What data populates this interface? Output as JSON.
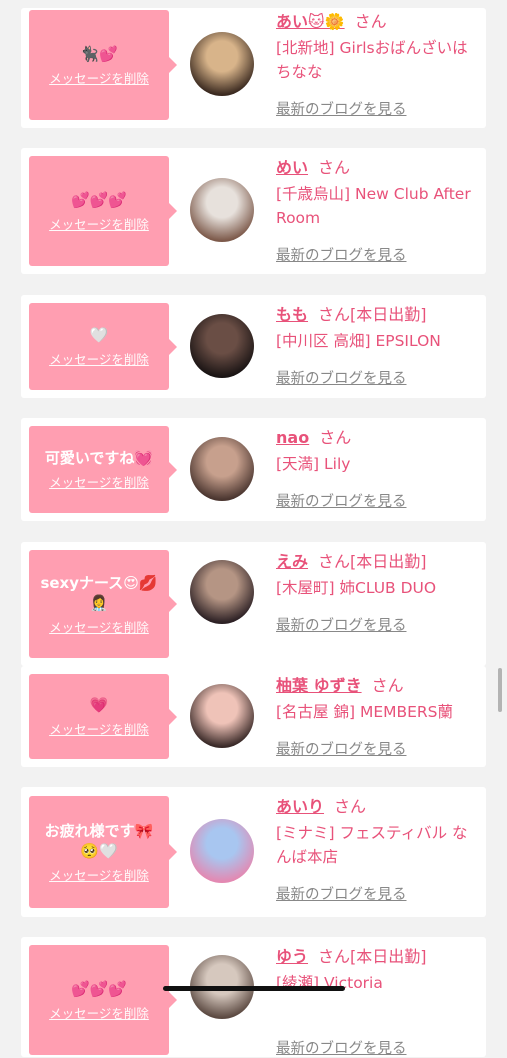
{
  "colors": {
    "accent": "#e8527a",
    "bubble": "#ff9eb1",
    "link_gray": "#888888"
  },
  "entries": [
    {
      "name": "あい🐱🌼",
      "honorific": "さん",
      "status": "",
      "shop": "[北新地] Girlsおばんざいはちなな",
      "message": "🐈‍⬛💕",
      "delete_label": "メッセージを削除",
      "blog_label": "最新のブログを見る",
      "avatar_icon": "avatar-girl-cat-filter"
    },
    {
      "name": "めい",
      "honorific": "さん",
      "status": "",
      "shop": "[千歳烏山] New Club After Room",
      "message": "💕💕💕",
      "delete_label": "メッセージを削除",
      "blog_label": "最新のブログを見る",
      "avatar_icon": "avatar-girl-selfie"
    },
    {
      "name": "もも",
      "honorific": "さん",
      "status": "[本日出勤]",
      "shop": "[中川区 高畑] EPSILON",
      "message": "🤍",
      "delete_label": "メッセージを削除",
      "blog_label": "最新のブログを見る",
      "avatar_icon": "avatar-girl-cat-ears"
    },
    {
      "name": "nao",
      "honorific": "さん",
      "status": "",
      "shop": "[天満] Lily",
      "message": "可愛いですね💓",
      "delete_label": "メッセージを削除",
      "blog_label": "最新のブログを見る",
      "avatar_icon": "avatar-girl-sparkle"
    },
    {
      "name": "えみ",
      "honorific": "さん",
      "status": "[本日出勤]",
      "shop": "[木屋町] 姉CLUB DUO",
      "message": "sexyナース😍💋👩‍⚕️",
      "delete_label": "メッセージを削除",
      "blog_label": "最新のブログを見る",
      "avatar_icon": "avatar-girl-portrait"
    },
    {
      "name": "柚葉 ゆずき",
      "honorific": "さん",
      "status": "",
      "shop": "[名古屋 錦] MEMBERS蘭",
      "message": "💗",
      "delete_label": "メッセージを削除",
      "blog_label": "最新のブログを見る",
      "avatar_icon": "avatar-girl-closeup"
    },
    {
      "name": "あいり",
      "honorific": "さん",
      "status": "",
      "shop": "[ミナミ] フェスティバル なんば本店",
      "message": "お疲れ様です🎀🥺🤍",
      "delete_label": "メッセージを削除",
      "blog_label": "最新のブログを見る",
      "avatar_icon": "avatar-girl-colorful"
    },
    {
      "name": "ゆう",
      "honorific": "さん",
      "status": "[本日出勤]",
      "shop": "[綾瀬] Victoria",
      "message": "💕💕💕",
      "delete_label": "メッセージを削除",
      "blog_label": "最新のブログを見る",
      "avatar_icon": "avatar-girl-hat"
    }
  ]
}
